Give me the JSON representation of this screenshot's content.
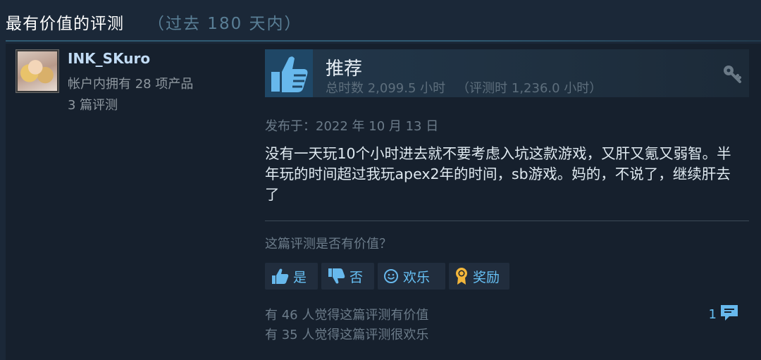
{
  "section": {
    "title": "最有价值的评测",
    "period": "（过去 180 天内）"
  },
  "review": {
    "author": {
      "name": "INK_SKuro",
      "products": "帐户内拥有 28 项产品",
      "reviews": "3 篇评测"
    },
    "recommendation": "推荐",
    "hours_total": "总时数 2,099.5 小时",
    "hours_at_review": "（评测时 1,236.0 小时）",
    "posted": "发布于：2022 年 10 月 13 日",
    "body": "没有一天玩10个小时进去就不要考虑入坑这款游戏，又肝又氪又弱智。半年玩的时间超过我玩apex2年的时间，sb游戏。妈的，不说了，继续肝去了",
    "helpful_question": "这篇评测是否有价值？",
    "buttons": {
      "yes": "是",
      "no": "否",
      "funny": "欢乐",
      "award": "奖励"
    },
    "helpful_count": "有 46 人觉得这篇评测有价值",
    "funny_count": "有 35 人觉得这篇评测很欢乐",
    "comment_count": "1"
  },
  "colors": {
    "background": "#1b2838",
    "card": "#16202d",
    "link": "#66c0f4",
    "award": "#f2b63b"
  },
  "icons": [
    "thumbs-up-icon",
    "key-icon",
    "thumbs-down-icon",
    "smiley-icon",
    "award-icon",
    "comment-icon"
  ]
}
